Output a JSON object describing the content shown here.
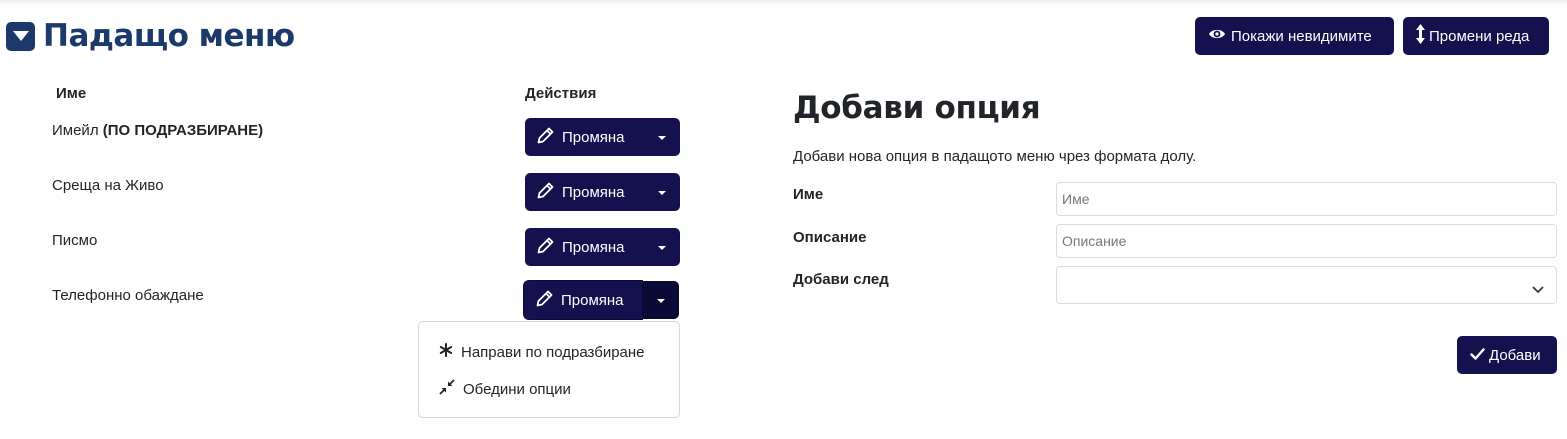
{
  "header": {
    "title": "Падащо меню",
    "title_icon": "caret-square-down-icon",
    "show_hidden_label": "Покажи невидимите",
    "show_hidden_icon": "eye-icon",
    "reorder_label": "Промени реда",
    "reorder_icon": "arrows-vertical-icon"
  },
  "table": {
    "columns": [
      "Име",
      "Действия"
    ],
    "rows": [
      {
        "name": "Имейл",
        "default_tag": "(ПО ПОДРАЗБИРАНЕ)",
        "action_label": "Промяна"
      },
      {
        "name": "Среща на Живо",
        "default_tag": "",
        "action_label": "Промяна"
      },
      {
        "name": "Писмо",
        "default_tag": "",
        "action_label": "Промяна"
      },
      {
        "name": "Телефонно обаждане",
        "default_tag": "",
        "action_label": "Промяна"
      }
    ],
    "action_icon": "pencil-icon"
  },
  "dropdown_menu": {
    "items": [
      {
        "label": "Направи по подразбиране",
        "icon": "asterisk-icon"
      },
      {
        "label": "Обедини опции",
        "icon": "compress-icon"
      }
    ]
  },
  "form": {
    "title": "Добави опция",
    "description": "Добави нова опция в падащото меню чрез формата долу.",
    "name_label": "Име",
    "name_placeholder": "Име",
    "name_value": "",
    "description_label": "Описание",
    "description_placeholder": "Описание",
    "description_value": "",
    "after_label": "Добави след",
    "after_value": "",
    "submit_label": "Добави",
    "submit_icon": "check-icon"
  },
  "colors": {
    "primary": "#14114e",
    "title": "#1b3a6b"
  }
}
